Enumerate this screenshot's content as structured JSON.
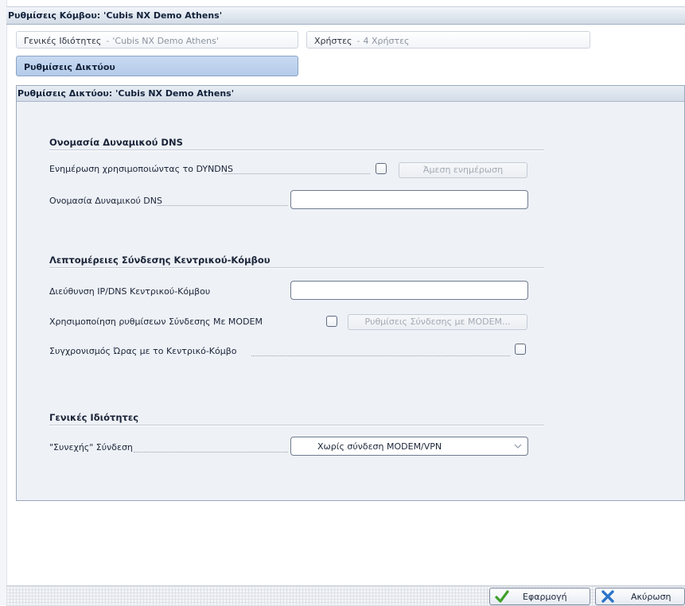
{
  "window": {
    "title": "Ρυθμίσεις Κόμβου: 'Cubis NX Demo Athens'"
  },
  "tabs": {
    "general": {
      "label": "Γενικές Ιδιότητες",
      "separator": "-",
      "detail": "'Cubis NX Demo Athens'"
    },
    "users": {
      "label": "Χρήστες",
      "separator": "-",
      "detail": "4 Χρήστες"
    },
    "network": {
      "label": "Ρυθμίσεις Δικτύου"
    }
  },
  "panel": {
    "title": "Ρυθμίσεις Δικτύου: 'Cubis NX Demo Athens'",
    "sections": {
      "dns": {
        "heading": "Ονομασία Δυναμικού DNS",
        "update_label": "Ενημέρωση χρησιμοποιώντας το DYNDNS",
        "update_checked": false,
        "update_now_button": "Άμεση ενημέρωση",
        "dns_name_label": "Ονομασία Δυναμικού DNS",
        "dns_name_value": ""
      },
      "connection": {
        "heading": "Λεπτομέρειες Σύνδεσης Κεντρικού-Κόμβου",
        "address_label": "Διεύθυνση IP/DNS Κεντρικού-Κόμβου",
        "address_value": "",
        "modem_label": "Χρησιμοποίηση ρυθμίσεων Σύνδεσης Με MODEM",
        "modem_checked": false,
        "modem_settings_button": "Ρυθμίσεις Σύνδεσης με MODEM...",
        "time_sync_label": "Συγχρονισμός Ώρας με το Κεντρικό-Κόμβο",
        "time_sync_checked": false
      },
      "general": {
        "heading": "Γενικές Ιδιότητες",
        "persistent_label": "\"Συνεχής\" Σύνδεση",
        "persistent_value": "Χωρίς σύνδεση MODEM/VPN"
      }
    }
  },
  "footer": {
    "apply_label": "Εφαρμογή",
    "cancel_label": "Ακύρωση"
  },
  "colors": {
    "apply_icon": "#3fa02a",
    "cancel_icon": "#2c74c8",
    "active_tab": "#bcd0ec",
    "panel_bg": "#eef1f6"
  },
  "icons": {
    "apply": "checkmark-icon",
    "cancel": "cross-icon",
    "select": "chevron-down-icon"
  }
}
